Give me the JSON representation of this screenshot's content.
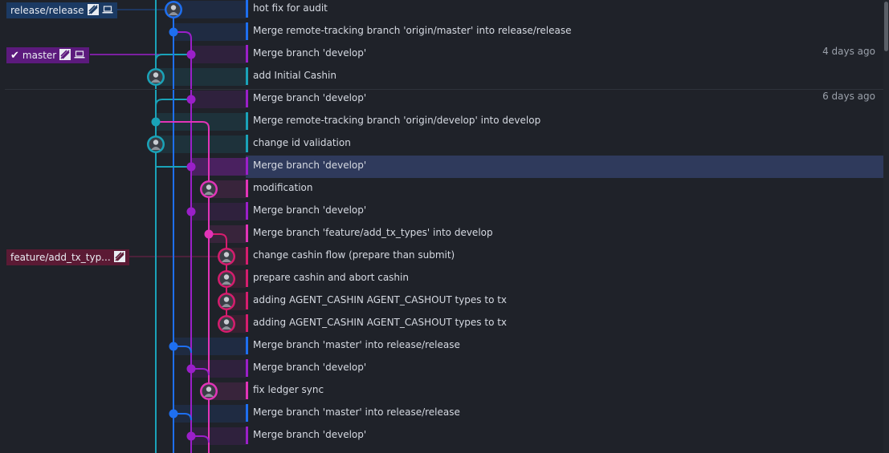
{
  "colors": {
    "background": "#1f2229",
    "selected_row": "#2f3a5c",
    "lane_teal": "#1aa3b8",
    "lane_blue": "#1e6ff0",
    "lane_purple": "#9b1fc9",
    "lane_magenta": "#e234b8",
    "lane_pink": "#d61d6e",
    "label_release": "#1b3a63",
    "label_master": "#5c1a7d",
    "label_feature": "#5b1a34"
  },
  "labels": [
    {
      "id": "release",
      "text": "release/release",
      "checked": false,
      "icons": [
        "gitkraken-icon",
        "laptop-icon"
      ]
    },
    {
      "id": "master",
      "text": "master",
      "checked": true,
      "icons": [
        "gitkraken-icon",
        "laptop-icon"
      ]
    },
    {
      "id": "feature",
      "text": "feature/add_tx_typ...",
      "checked": false,
      "icons": [
        "gitkraken-icon"
      ]
    }
  ],
  "commits": [
    {
      "message": "hot fix for audit",
      "date": ""
    },
    {
      "message": "Merge remote-tracking branch 'origin/master' into release/release",
      "date": ""
    },
    {
      "message": "Merge branch 'develop'",
      "date": "4 days ago"
    },
    {
      "message": "add Initial Cashin",
      "date": ""
    },
    {
      "message": "Merge branch 'develop'",
      "date": "6 days ago"
    },
    {
      "message": "Merge remote-tracking branch 'origin/develop' into develop",
      "date": ""
    },
    {
      "message": "change id validation",
      "date": ""
    },
    {
      "message": "Merge branch 'develop'",
      "date": "",
      "selected": true
    },
    {
      "message": "modification",
      "date": ""
    },
    {
      "message": "Merge branch 'develop'",
      "date": ""
    },
    {
      "message": "Merge branch 'feature/add_tx_types' into develop",
      "date": ""
    },
    {
      "message": "change cashin flow (prepare than submit)",
      "date": ""
    },
    {
      "message": "prepare cashin and abort cashin",
      "date": ""
    },
    {
      "message": "adding AGENT_CASHIN AGENT_CASHOUT types to tx",
      "date": ""
    },
    {
      "message": "adding AGENT_CASHIN AGENT_CASHOUT types to tx",
      "date": ""
    },
    {
      "message": "Merge branch 'master' into release/release",
      "date": ""
    },
    {
      "message": "Merge branch 'develop'",
      "date": ""
    },
    {
      "message": "fix ledger sync",
      "date": ""
    },
    {
      "message": "Merge branch 'master' into release/release",
      "date": ""
    },
    {
      "message": "Merge branch 'develop'",
      "date": ""
    }
  ]
}
